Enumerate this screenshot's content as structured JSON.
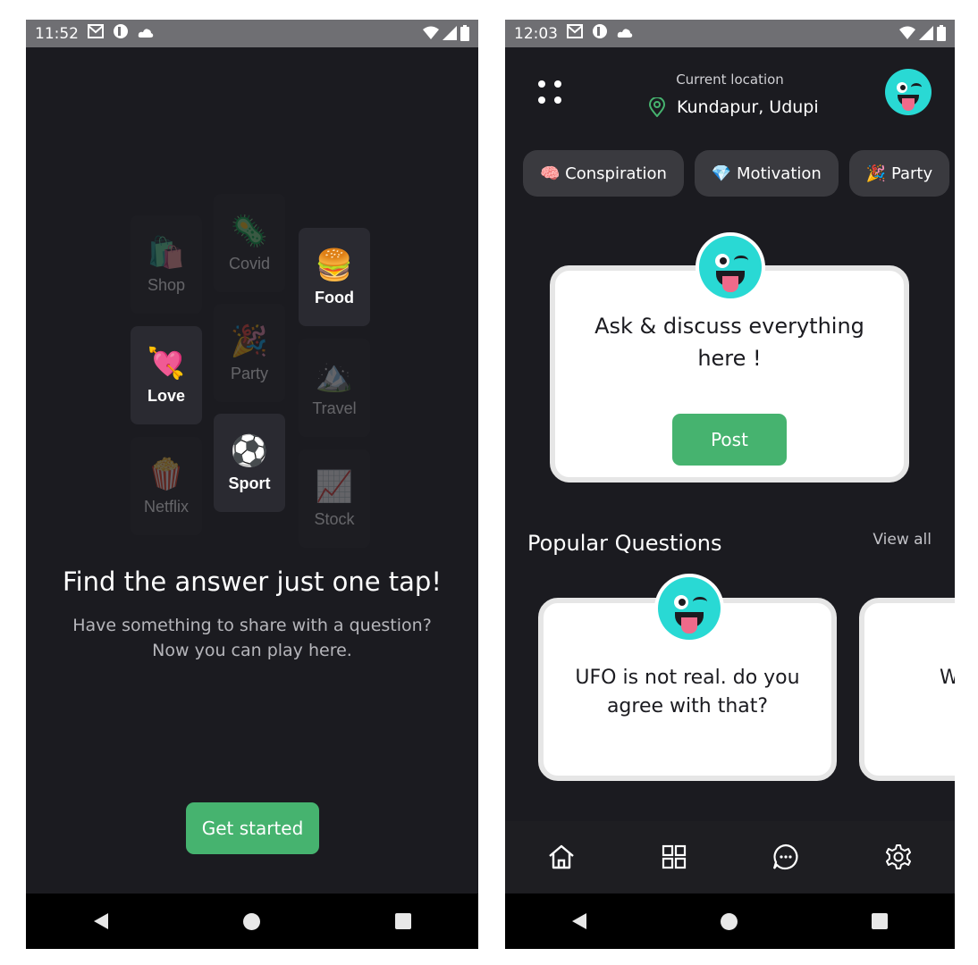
{
  "screen1": {
    "status": {
      "time": "11:52"
    },
    "tiles": [
      {
        "emoji": "🛍️",
        "label": "Shop"
      },
      {
        "emoji": "🦠",
        "label": "Covid"
      },
      {
        "emoji": "🍔",
        "label": "Food"
      },
      {
        "emoji": "💘",
        "label": "Love"
      },
      {
        "emoji": "🎉",
        "label": "Party"
      },
      {
        "emoji": "🏔️",
        "label": "Travel"
      },
      {
        "emoji": "🍿",
        "label": "Netflix"
      },
      {
        "emoji": "⚽",
        "label": "Sport"
      },
      {
        "emoji": "📈",
        "label": "Stock"
      }
    ],
    "headline": "Find the answer just one tap!",
    "subtext": "Have something to share with a question? Now you can play here.",
    "cta_label": "Get started"
  },
  "screen2": {
    "status": {
      "time": "12:03"
    },
    "location_title": "Current location",
    "location_value": "Kundapur, Udupi",
    "chips": [
      {
        "emoji": "🧠",
        "label": "Conspiration"
      },
      {
        "emoji": "💎",
        "label": "Motivation"
      },
      {
        "emoji": "🎉",
        "label": "Party"
      }
    ],
    "ask_text": "Ask & discuss everything here !",
    "post_label": "Post",
    "section_title": "Popular Questions",
    "view_all": "View all",
    "questions": [
      {
        "text": "UFO is not real. do you agree with that?"
      },
      {
        "text": "Wha ab"
      }
    ],
    "tabs": [
      "home-icon",
      "grid-icon",
      "chat-icon",
      "settings-icon"
    ]
  },
  "colors": {
    "background": "#1b1b20",
    "accent": "#46b36f",
    "avatar": "#29d9d4"
  }
}
